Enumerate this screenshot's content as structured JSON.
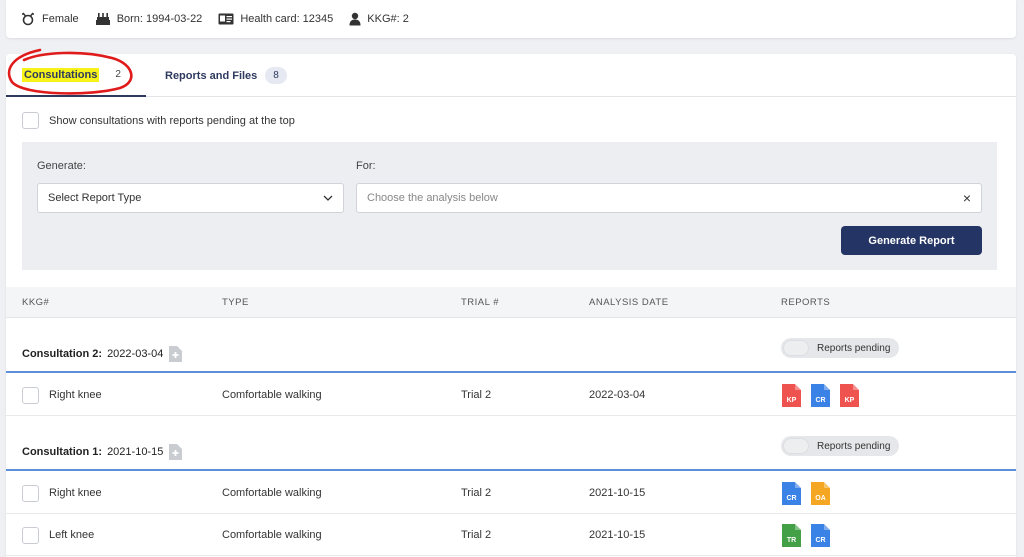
{
  "patient": {
    "sex": "Female",
    "born": "Born: 1994-03-22",
    "health_card": "Health card: 12345",
    "kkg": "KKG#: 2"
  },
  "tabs": [
    {
      "label": "Consultations",
      "count": "2",
      "active": true
    },
    {
      "label": "Reports and Files",
      "count": "8",
      "active": false
    }
  ],
  "pending_toggle_label": "Show consultations with reports pending at the top",
  "generate": {
    "generate_label": "Generate:",
    "for_label": "For:",
    "select_value": "Select Report Type",
    "for_placeholder": "Choose the analysis below",
    "button_label": "Generate Report"
  },
  "table": {
    "headers": [
      "KKG#",
      "TYPE",
      "TRIAL #",
      "ANALYSIS DATE",
      "REPORTS"
    ],
    "pending_label": "Reports pending",
    "groups": [
      {
        "title": "Consultation 2:",
        "date": "2022-03-04",
        "rows": [
          {
            "kkg": "Right knee",
            "type": "Comfortable walking",
            "trial": "Trial 2",
            "date": "2022-03-04",
            "reports": [
              "KP",
              "CR",
              "KP"
            ]
          }
        ]
      },
      {
        "title": "Consultation 1:",
        "date": "2021-10-15",
        "rows": [
          {
            "kkg": "Right knee",
            "type": "Comfortable walking",
            "trial": "Trial 2",
            "date": "2021-10-15",
            "reports": [
              "CR",
              "OA"
            ]
          },
          {
            "kkg": "Left knee",
            "type": "Comfortable walking",
            "trial": "Trial 2",
            "date": "2021-10-15",
            "reports": [
              "TR",
              "CR"
            ]
          }
        ]
      }
    ]
  },
  "report_colors": {
    "KP": "#ef5350",
    "CR": "#3b82e6",
    "OA": "#f5a623",
    "TR": "#43a047"
  },
  "accent": "#243565",
  "highlight": "#f6f21a",
  "annotation_circle": "#e01b1b"
}
